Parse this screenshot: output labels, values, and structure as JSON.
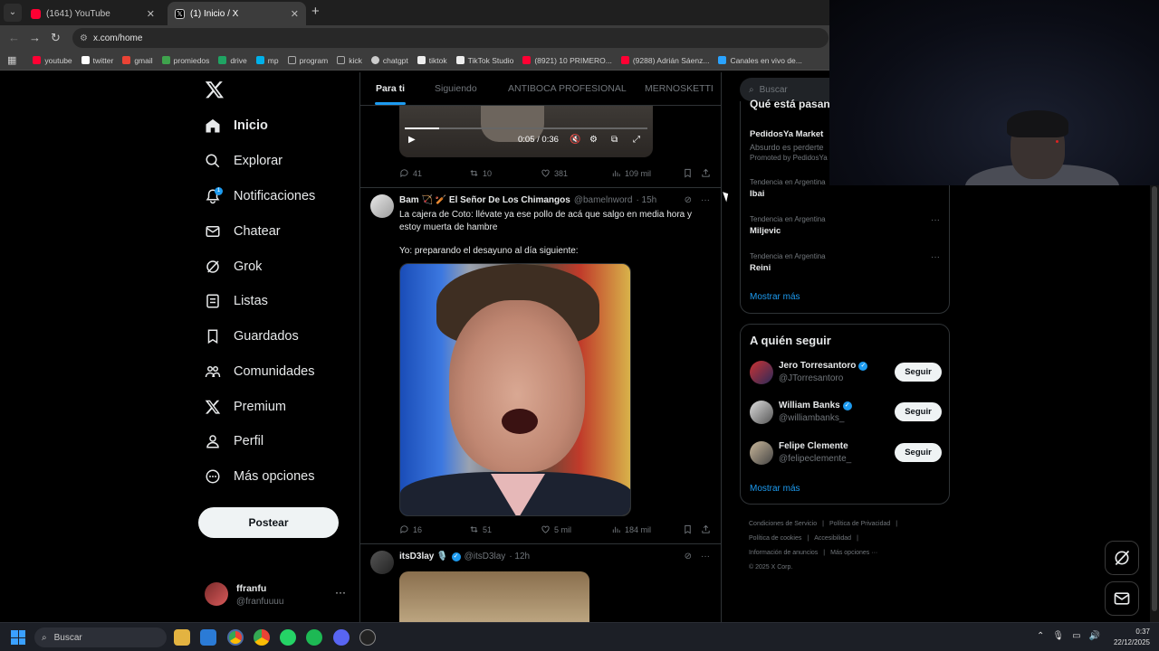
{
  "browser": {
    "tabs": [
      {
        "title": "(1641) YouTube",
        "color": "#ff0033"
      },
      {
        "title": "(1) Inicio / X",
        "color": "#ffffff"
      }
    ],
    "new_tab": "+",
    "url": "x.com/home",
    "bookmarks": [
      {
        "label": "youtube",
        "color": "#ff0033"
      },
      {
        "label": "twitter",
        "color": "#ffffff"
      },
      {
        "label": "gmail",
        "color": "#ea4335"
      },
      {
        "label": "promiedos",
        "color": "#3fa34d"
      },
      {
        "label": "drive",
        "color": "#1fa463"
      },
      {
        "label": "mp",
        "color": "#00b1ea"
      },
      {
        "label": "program",
        "color": "#888888"
      },
      {
        "label": "kick",
        "color": "#888888"
      },
      {
        "label": "chatgpt",
        "color": "#cccccc"
      },
      {
        "label": "tiktok",
        "color": "#eeeeee"
      },
      {
        "label": "TikTok Studio",
        "color": "#eeeeee"
      },
      {
        "label": "(8921) 10 PRIMERO...",
        "color": "#ff0033"
      },
      {
        "label": "(9288) Adrián Sáenz...",
        "color": "#ff0033"
      },
      {
        "label": "Canales en vivo de...",
        "color": "#2aa3ff"
      }
    ]
  },
  "nav": {
    "items": [
      {
        "label": "Inicio",
        "icon": "home-icon"
      },
      {
        "label": "Explorar",
        "icon": "search-icon"
      },
      {
        "label": "Notificaciones",
        "icon": "bell-icon",
        "badge": "1"
      },
      {
        "label": "Chatear",
        "icon": "mail-icon"
      },
      {
        "label": "Grok",
        "icon": "grok-icon"
      },
      {
        "label": "Listas",
        "icon": "list-icon"
      },
      {
        "label": "Guardados",
        "icon": "bookmark-icon"
      },
      {
        "label": "Comunidades",
        "icon": "people-icon"
      },
      {
        "label": "Premium",
        "icon": "x-icon"
      },
      {
        "label": "Perfil",
        "icon": "person-icon"
      },
      {
        "label": "Más opciones",
        "icon": "more-circle-icon"
      }
    ],
    "post_button": "Postear",
    "profile": {
      "name": "ffranfu",
      "handle": "@franfuuuu",
      "more": "···"
    }
  },
  "home_tabs": [
    "Para ti",
    "Siguiendo",
    "ANTIBOCA PROFESIONAL",
    "MERNOSKETTI"
  ],
  "feed": {
    "video_post": {
      "time": "0:05 / 0:36",
      "progress": 0.14,
      "actions": {
        "replies": "41",
        "reposts": "10",
        "likes": "381",
        "views": "109 mil"
      }
    },
    "post2": {
      "name": "Bam 🏹 🏏 El Señor De Los Chimangos",
      "handle": "@bamelnword",
      "time": "· 15h",
      "text1": "La cajera de Coto: llévate ya ese pollo de acá que salgo en media hora y estoy muerta de hambre",
      "text2": "Yo: preparando el desayuno al día siguiente:",
      "actions": {
        "replies": "16",
        "reposts": "51",
        "likes": "5 mil",
        "views": "184 mil"
      }
    },
    "post3": {
      "name": "itsD3lay 🎙️",
      "handle": "@itsD3lay",
      "time": "· 12h"
    }
  },
  "sidebar": {
    "search_placeholder": "Buscar",
    "trends_title": "Qué está pasando",
    "promoted": {
      "name": "PedidosYa Market",
      "desc": "Absurdo es perderte",
      "label": "Promoted by PedidosYa"
    },
    "trends": [
      {
        "context": "Tendencia en Argentina",
        "name": "Ibai"
      },
      {
        "context": "Tendencia en Argentina",
        "name": "Miljevic"
      },
      {
        "context": "Tendencia en Argentina",
        "name": "Reini"
      }
    ],
    "trends_more": "Mostrar más",
    "follow_title": "A quién seguir",
    "follow": [
      {
        "name": "Jero Torresantoro",
        "handle": "@JTorresantoro",
        "button": "Seguir"
      },
      {
        "name": "William Banks",
        "handle": "@williambanks_",
        "button": "Seguir"
      },
      {
        "name": "Felipe Clemente",
        "handle": "@felipeclemente_",
        "button": "Seguir"
      }
    ],
    "follow_more": "Mostrar más",
    "footer": [
      "Condiciones de Servicio",
      "|",
      "Política de Privacidad",
      "|",
      "Política de cookies",
      "|",
      "Accesibilidad",
      "|",
      "Información de anuncios",
      "|",
      "Más opciones ···",
      "© 2025 X Corp."
    ]
  },
  "taskbar": {
    "search": "Buscar",
    "time": "0:37",
    "date": "22/12/2025"
  }
}
